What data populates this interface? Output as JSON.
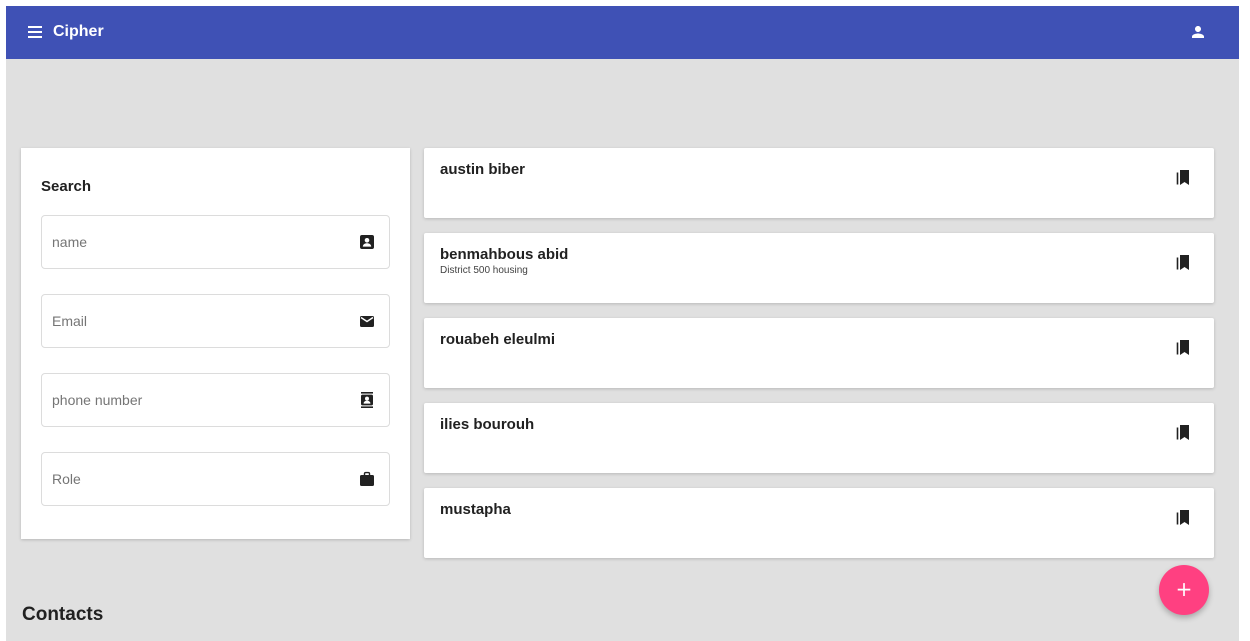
{
  "app": {
    "title": "Cipher",
    "primary_color": "#3f51b5",
    "accent_color": "#ff4081",
    "menu_icon": "menu-icon",
    "account_icon": "account-icon"
  },
  "search": {
    "title": "Search",
    "fields": [
      {
        "placeholder": "name",
        "value": "",
        "icon": "contact-card-icon"
      },
      {
        "placeholder": "Email",
        "value": "",
        "icon": "mail-icon"
      },
      {
        "placeholder": "phone number",
        "value": "",
        "icon": "contacts-book-icon"
      },
      {
        "placeholder": "Role",
        "value": "",
        "icon": "briefcase-icon"
      }
    ]
  },
  "contacts": {
    "section_title": "Contacts",
    "items": [
      {
        "name": "austin biber",
        "subtitle": ""
      },
      {
        "name": "benmahbous abid",
        "subtitle": "District 500 housing"
      },
      {
        "name": "rouabeh eleulmi",
        "subtitle": ""
      },
      {
        "name": "ilies bourouh",
        "subtitle": ""
      },
      {
        "name": "mustapha",
        "subtitle": ""
      }
    ],
    "item_icon": "bookmarks-icon"
  },
  "fab": {
    "label": "+",
    "icon": "add-icon"
  }
}
